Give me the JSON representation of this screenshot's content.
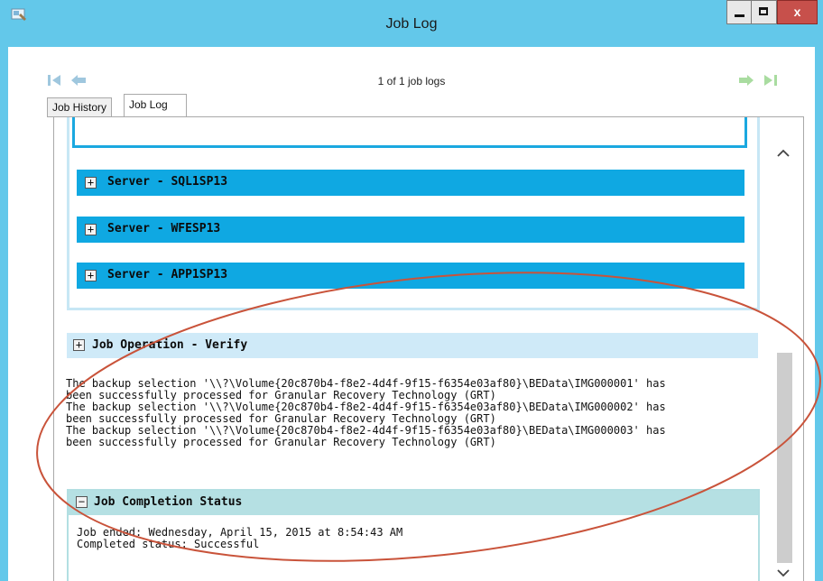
{
  "window": {
    "title": "Job Log",
    "close_glyph": "x",
    "icons": [
      "app-icon",
      "minimize-icon",
      "maximize-icon",
      "close-icon"
    ]
  },
  "nav": {
    "counter": "1 of 1 job logs",
    "icons": [
      "first-icon",
      "previous-icon",
      "next-icon",
      "last-icon"
    ]
  },
  "tabs": [
    {
      "label": "Job History",
      "active": false
    },
    {
      "label": "Job Log",
      "active": true
    }
  ],
  "servers": [
    {
      "label": "Server - SQL1SP13",
      "expand": "+"
    },
    {
      "label": "Server - WFESP13",
      "expand": "+"
    },
    {
      "label": "Server - APP1SP13",
      "expand": "+"
    }
  ],
  "verify": {
    "label": "Job Operation - Verify",
    "expand": "+",
    "lines": [
      "The backup selection '\\\\?\\Volume{20c870b4-f8e2-4d4f-9f15-f6354e03af80}\\BEData\\IMG000001' has",
      "been successfully processed for Granular Recovery Technology (GRT)",
      "The backup selection '\\\\?\\Volume{20c870b4-f8e2-4d4f-9f15-f6354e03af80}\\BEData\\IMG000002' has",
      "been successfully processed for Granular Recovery Technology (GRT)",
      "The backup selection '\\\\?\\Volume{20c870b4-f8e2-4d4f-9f15-f6354e03af80}\\BEData\\IMG000003' has",
      "been successfully processed for Granular Recovery Technology (GRT)"
    ]
  },
  "completion": {
    "label": "Job Completion Status",
    "collapse": "−",
    "ended": "Job ended: Wednesday, April 15, 2015 at 8:54:43 AM",
    "status": "Completed status: Successful"
  },
  "colors": {
    "title_bar": "#63c8ea",
    "server_bar": "#0fa8e2",
    "verify_bar": "#cfeaf8",
    "completion_bar": "#b5e0e3",
    "annotation": "#c9533a",
    "close_button": "#c7504b"
  }
}
